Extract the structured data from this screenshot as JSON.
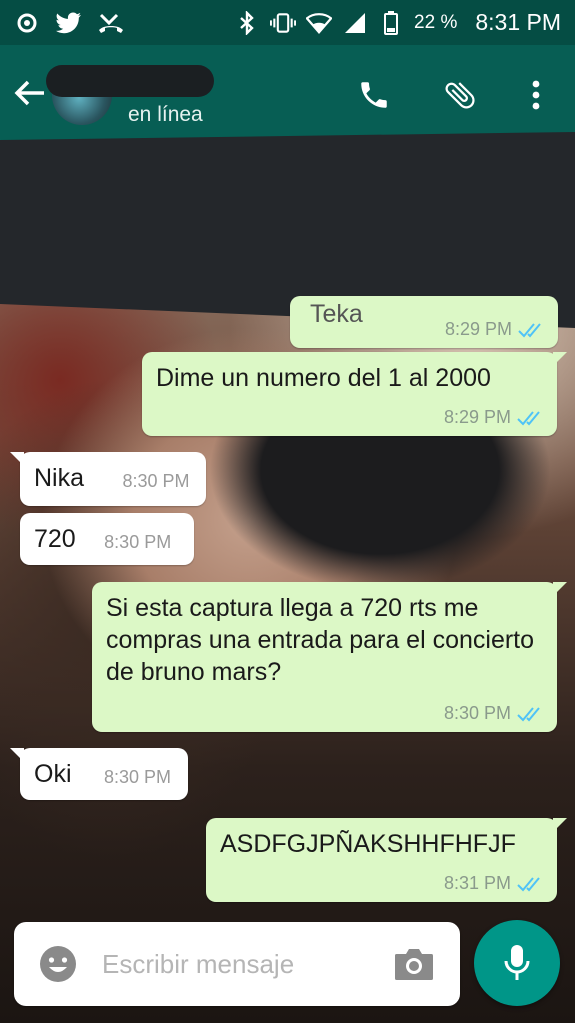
{
  "status_bar": {
    "left_icons": [
      "whatsapp-status-icon",
      "twitter-icon",
      "missed-call-icon"
    ],
    "right_icons": [
      "bluetooth-icon",
      "vibrate-icon",
      "wifi-icon",
      "signal-icon",
      "battery-icon"
    ],
    "battery": "22 %",
    "time": "8:31 PM"
  },
  "header": {
    "contact_name": "",
    "contact_status": "en línea",
    "actions": [
      "back-arrow-icon",
      "phone-icon",
      "paperclip-icon",
      "more-vert-icon"
    ]
  },
  "messages": [
    {
      "direction": "out",
      "text": "Teka",
      "time": "8:29 PM",
      "status": "read"
    },
    {
      "direction": "out",
      "text": "Dime un numero del 1 al 2000",
      "time": "8:29 PM",
      "status": "read"
    },
    {
      "direction": "in",
      "text": "Nika",
      "time": "8:30 PM"
    },
    {
      "direction": "in",
      "text": "720",
      "time": "8:30 PM"
    },
    {
      "direction": "out",
      "text": "Si esta captura llega a 720 rts me compras una entrada para el concierto de bruno mars?",
      "time": "8:30 PM",
      "status": "read"
    },
    {
      "direction": "in",
      "text": "Oki",
      "time": "8:30 PM"
    },
    {
      "direction": "out",
      "text": "ASDFGJPÑAKSHHFHFJF",
      "time": "8:31 PM",
      "status": "read"
    }
  ],
  "input": {
    "placeholder": "Escribir mensaje"
  },
  "colors": {
    "status_bar": "#054d44",
    "app_bar": "#075e54",
    "outgoing_bubble": "#dcf8c6",
    "incoming_bubble": "#ffffff",
    "read_ticks": "#4fc3f7",
    "mic_button": "#009688"
  }
}
